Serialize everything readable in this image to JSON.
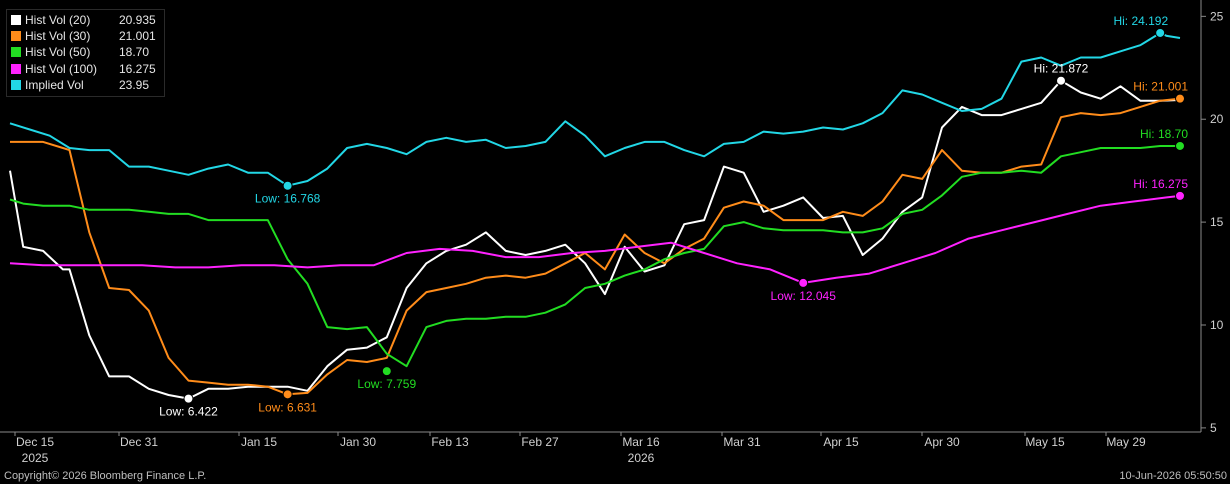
{
  "footer": {
    "copyright": "Copyright© 2026 Bloomberg Finance L.P.",
    "timestamp": "10-Jun-2026 05:50:50"
  },
  "legend": [
    {
      "name": "Hist Vol (20)",
      "value": "20.935",
      "color": "#ffffff"
    },
    {
      "name": "Hist Vol (30)",
      "value": "21.001",
      "color": "#ff8c1a"
    },
    {
      "name": "Hist Vol (50)",
      "value": "18.70",
      "color": "#22dd22"
    },
    {
      "name": "Hist Vol (100)",
      "value": "16.275",
      "color": "#ff22ff"
    },
    {
      "name": "Implied Vol",
      "value": "23.95",
      "color": "#22d7e6"
    }
  ],
  "chart_data": {
    "type": "line",
    "x_ticks": [
      "Dec 15",
      "Dec 31",
      "Jan 15",
      "Jan 30",
      "Feb 13",
      "Feb 27",
      "Mar 16",
      "Mar 31",
      "Apr 15",
      "Apr 30",
      "May 15",
      "May 29"
    ],
    "year_labels": [
      {
        "label": "2025",
        "at": "Dec 15"
      },
      {
        "label": "2026",
        "at": "Mar 16"
      }
    ],
    "y_ticks": [
      5,
      10,
      15,
      20,
      25
    ],
    "ylim": [
      4.8,
      25.6
    ],
    "xlim": [
      0,
      177
    ],
    "grid": false,
    "legend_position": "top-left",
    "series": [
      {
        "name": "Hist Vol (20)",
        "color": "#ffffff",
        "x": [
          0,
          2,
          5,
          8,
          9,
          12,
          15,
          18,
          21,
          24,
          27,
          30,
          33,
          36,
          39,
          42,
          45,
          48,
          51,
          54,
          57,
          60,
          63,
          66,
          69,
          72,
          75,
          78,
          81,
          84,
          87,
          90,
          93,
          96,
          99,
          102,
          105,
          108,
          111,
          114,
          117,
          120,
          123,
          126,
          129,
          132,
          135,
          138,
          141,
          144,
          147,
          150,
          153,
          156,
          159,
          162,
          165,
          168,
          171,
          174,
          177
        ],
        "y": [
          17.5,
          13.8,
          13.6,
          12.7,
          12.7,
          9.5,
          7.5,
          7.5,
          6.9,
          6.6,
          6.422,
          6.9,
          6.9,
          7.0,
          7.0,
          7.0,
          6.8,
          8.0,
          8.8,
          8.9,
          9.4,
          11.8,
          13.0,
          13.6,
          13.9,
          14.5,
          13.6,
          13.4,
          13.6,
          13.9,
          13.0,
          11.5,
          13.8,
          12.6,
          12.9,
          14.9,
          15.1,
          17.7,
          17.4,
          15.5,
          15.8,
          16.2,
          15.2,
          15.3,
          13.4,
          14.2,
          15.5,
          16.2,
          19.6,
          20.6,
          20.2,
          20.2,
          20.5,
          20.8,
          21.872,
          21.3,
          21.0,
          21.6,
          20.9,
          20.9,
          20.935
        ]
      },
      {
        "name": "Hist Vol (30)",
        "color": "#ff8c1a",
        "x": [
          0,
          2,
          5,
          8,
          9,
          12,
          15,
          18,
          21,
          24,
          27,
          30,
          33,
          36,
          39,
          42,
          45,
          48,
          51,
          54,
          57,
          60,
          63,
          66,
          69,
          72,
          75,
          78,
          81,
          84,
          87,
          90,
          93,
          96,
          99,
          102,
          105,
          108,
          111,
          114,
          117,
          120,
          123,
          126,
          129,
          132,
          135,
          138,
          141,
          144,
          147,
          150,
          153,
          156,
          159,
          162,
          165,
          168,
          171,
          174,
          177
        ],
        "y": [
          18.9,
          18.9,
          18.9,
          18.6,
          18.5,
          14.5,
          11.8,
          11.7,
          10.7,
          8.4,
          7.3,
          7.2,
          7.1,
          7.1,
          7.0,
          6.631,
          6.7,
          7.6,
          8.3,
          8.2,
          8.4,
          10.7,
          11.6,
          11.8,
          12.0,
          12.3,
          12.4,
          12.3,
          12.5,
          13.0,
          13.5,
          12.7,
          14.4,
          13.5,
          13.0,
          13.7,
          14.2,
          15.7,
          16.0,
          15.8,
          15.1,
          15.1,
          15.1,
          15.5,
          15.3,
          16.0,
          17.3,
          17.1,
          18.5,
          17.5,
          17.4,
          17.4,
          17.7,
          17.8,
          20.1,
          20.3,
          20.2,
          20.3,
          20.6,
          20.9,
          21.001
        ]
      },
      {
        "name": "Hist Vol (50)",
        "color": "#22dd22",
        "x": [
          0,
          2,
          5,
          8,
          9,
          12,
          15,
          18,
          21,
          24,
          27,
          30,
          33,
          36,
          39,
          42,
          45,
          48,
          51,
          54,
          57,
          60,
          63,
          66,
          69,
          72,
          75,
          78,
          81,
          84,
          87,
          90,
          93,
          96,
          99,
          102,
          105,
          108,
          111,
          114,
          117,
          120,
          123,
          126,
          129,
          132,
          135,
          138,
          141,
          144,
          147,
          150,
          153,
          156,
          159,
          162,
          165,
          168,
          171,
          174,
          177
        ],
        "y": [
          16.1,
          15.9,
          15.8,
          15.8,
          15.8,
          15.6,
          15.6,
          15.6,
          15.5,
          15.4,
          15.4,
          15.1,
          15.1,
          15.1,
          15.1,
          13.2,
          12.0,
          9.9,
          9.8,
          9.9,
          8.6,
          8.0,
          9.9,
          10.2,
          10.3,
          10.3,
          10.4,
          10.4,
          10.6,
          11.0,
          11.8,
          12.0,
          12.4,
          12.7,
          13.2,
          13.5,
          13.7,
          14.8,
          15.0,
          14.7,
          14.6,
          14.6,
          14.6,
          14.5,
          14.5,
          14.7,
          15.4,
          15.6,
          16.3,
          17.2,
          17.4,
          17.4,
          17.5,
          17.4,
          18.2,
          18.4,
          18.6,
          18.6,
          18.6,
          18.7,
          18.7
        ]
      },
      {
        "name": "Hist Vol (100)",
        "color": "#ff22ff",
        "x": [
          0,
          5,
          10,
          15,
          20,
          25,
          30,
          35,
          40,
          45,
          50,
          55,
          60,
          65,
          70,
          75,
          80,
          85,
          90,
          95,
          100,
          105,
          110,
          115,
          120,
          125,
          130,
          135,
          140,
          145,
          150,
          155,
          160,
          165,
          170,
          175,
          177
        ],
        "y": [
          13.0,
          12.9,
          12.9,
          12.9,
          12.9,
          12.8,
          12.8,
          12.9,
          12.9,
          12.8,
          12.9,
          12.9,
          13.5,
          13.7,
          13.6,
          13.3,
          13.3,
          13.5,
          13.6,
          13.8,
          14.0,
          13.5,
          13.0,
          12.7,
          12.045,
          12.3,
          12.5,
          13.0,
          13.5,
          14.2,
          14.6,
          15.0,
          15.4,
          15.8,
          16.0,
          16.2,
          16.275
        ]
      },
      {
        "name": "Implied Vol",
        "color": "#22d7e6",
        "x": [
          0,
          3,
          6,
          9,
          12,
          15,
          18,
          21,
          24,
          27,
          30,
          33,
          36,
          39,
          42,
          45,
          48,
          51,
          54,
          57,
          60,
          63,
          66,
          69,
          72,
          75,
          78,
          81,
          84,
          87,
          90,
          93,
          96,
          99,
          102,
          105,
          108,
          111,
          114,
          117,
          120,
          123,
          126,
          129,
          132,
          135,
          138,
          141,
          144,
          147,
          150,
          153,
          156,
          159,
          162,
          165,
          168,
          171,
          174,
          175,
          177
        ],
        "y": [
          19.8,
          19.5,
          19.2,
          18.6,
          18.5,
          18.5,
          17.7,
          17.7,
          17.5,
          17.3,
          17.6,
          17.8,
          17.4,
          17.4,
          16.768,
          17.0,
          17.6,
          18.6,
          18.8,
          18.6,
          18.3,
          18.9,
          19.1,
          18.9,
          19.0,
          18.6,
          18.7,
          18.9,
          19.9,
          19.2,
          18.2,
          18.6,
          18.9,
          18.9,
          18.5,
          18.2,
          18.8,
          18.9,
          19.4,
          19.3,
          19.4,
          19.6,
          19.5,
          19.8,
          20.3,
          21.4,
          21.2,
          20.8,
          20.4,
          20.5,
          21.0,
          22.8,
          23.0,
          22.6,
          23.0,
          23.0,
          23.3,
          23.6,
          24.192,
          24.05,
          23.95
        ]
      }
    ],
    "annotations": [
      {
        "text": "Low: 6.422",
        "series": 0,
        "x": 27,
        "y": 6.422,
        "side": "below"
      },
      {
        "text": "Low: 6.631",
        "series": 1,
        "x": 42,
        "y": 6.631,
        "side": "below"
      },
      {
        "text": "Low: 7.759",
        "series": 2,
        "x": 57,
        "y": 7.759,
        "side": "below"
      },
      {
        "text": "Low: 12.045",
        "series": 3,
        "x": 120,
        "y": 12.045,
        "side": "below"
      },
      {
        "text": "Low: 16.768",
        "series": 4,
        "x": 42,
        "y": 16.768,
        "side": "below"
      },
      {
        "text": "Hi: 21.872",
        "series": 0,
        "x": 159,
        "y": 21.872,
        "side": "above"
      },
      {
        "text": "Hi: 21.001",
        "series": 1,
        "x": 177,
        "y": 21.001,
        "side": "above"
      },
      {
        "text": "Hi: 18.70",
        "series": 2,
        "x": 177,
        "y": 18.7,
        "side": "above"
      },
      {
        "text": "Hi: 16.275",
        "series": 3,
        "x": 177,
        "y": 16.275,
        "side": "above"
      },
      {
        "text": "Hi: 24.192",
        "series": 4,
        "x": 174,
        "y": 24.192,
        "side": "above"
      }
    ]
  }
}
